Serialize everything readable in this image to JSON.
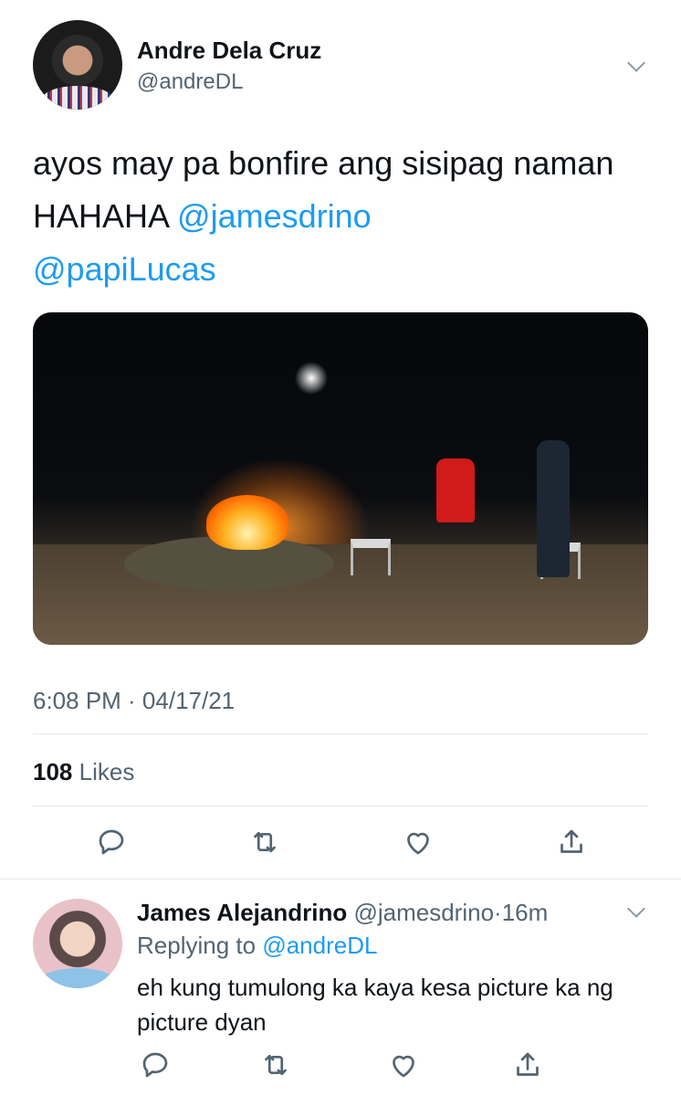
{
  "tweet": {
    "author_name": "Andre Dela Cruz",
    "author_handle": "@andreDL",
    "text": "ayos may pa bonfire ang sisipag naman HAHAHA ",
    "mentions": [
      "@jamesdrino",
      "@papiLucas"
    ],
    "timestamp": "6:08 PM · 04/17/21",
    "likes_count": "108",
    "likes_label": "Likes",
    "actions": [
      "reply-icon",
      "retweet-icon",
      "like-icon",
      "share-icon"
    ]
  },
  "reply": {
    "author_name": "James Alejandrino",
    "author_handle": "@jamesdrino",
    "time": "16m",
    "replying_prefix": "Replying to ",
    "replying_to": "@andreDL",
    "text": "eh kung tumulong ka kaya kesa picture ka ng picture dyan",
    "actions": [
      "reply-icon",
      "retweet-icon",
      "like-icon",
      "share-icon"
    ]
  },
  "colors": {
    "link": "#1d9bf0",
    "secondary_text": "#536471",
    "divider": "#e1e8ed"
  }
}
